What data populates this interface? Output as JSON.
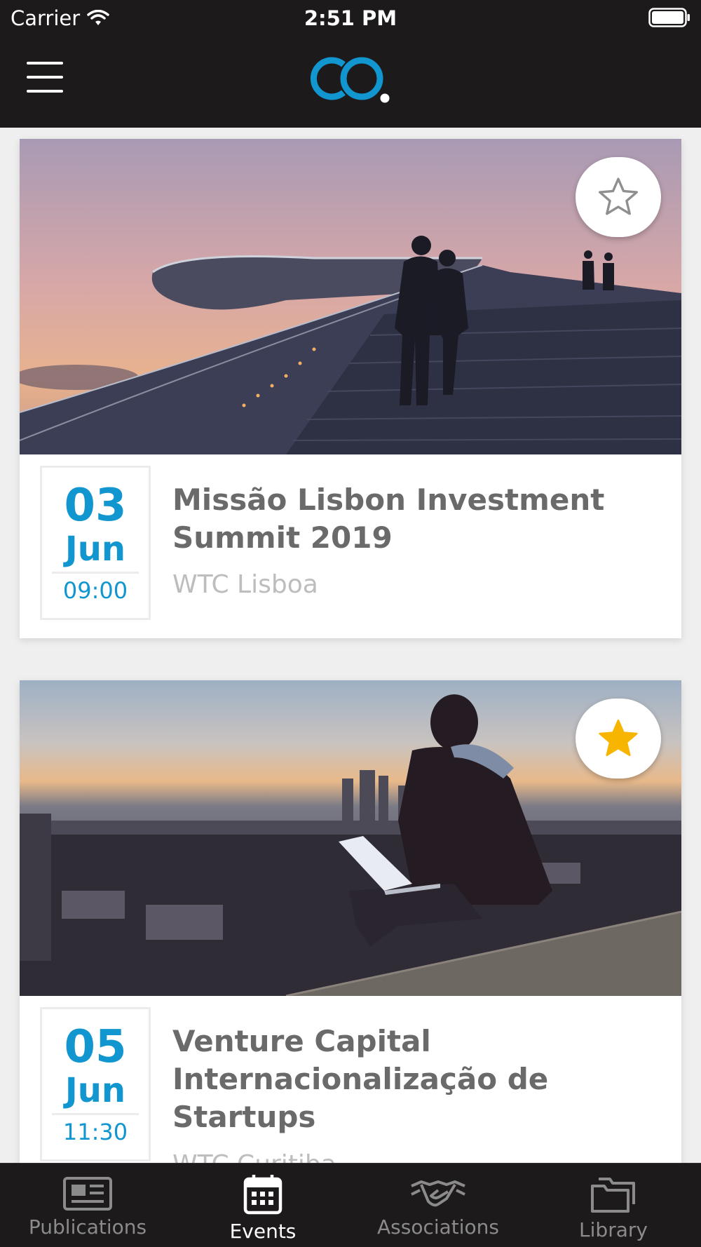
{
  "status_bar": {
    "carrier": "Carrier",
    "time": "2:51 PM"
  },
  "header": {
    "logo_text": "CO."
  },
  "events": [
    {
      "day": "03",
      "month": "Jun",
      "time": "09:00",
      "title": "Missão Lisbon Investment Summit 2019",
      "location": "WTC Lisboa",
      "favorite": false,
      "image_icon": "architecture-stairs-photo"
    },
    {
      "day": "05",
      "month": "Jun",
      "time": "11:30",
      "title": "Venture Capital Internacionalização de Startups",
      "location": "WTC Curitiba",
      "favorite": true,
      "image_icon": "man-with-laptop-city-photo"
    }
  ],
  "tabs": [
    {
      "label": "Publications",
      "icon": "newspaper-icon",
      "active": false
    },
    {
      "label": "Events",
      "icon": "calendar-icon",
      "active": true
    },
    {
      "label": "Associations",
      "icon": "handshake-icon",
      "active": false
    },
    {
      "label": "Library",
      "icon": "folder-icon",
      "active": false
    }
  ],
  "colors": {
    "accent": "#1296cf",
    "star_active": "#f7b500",
    "bar_bg": "#1c1a1b"
  }
}
